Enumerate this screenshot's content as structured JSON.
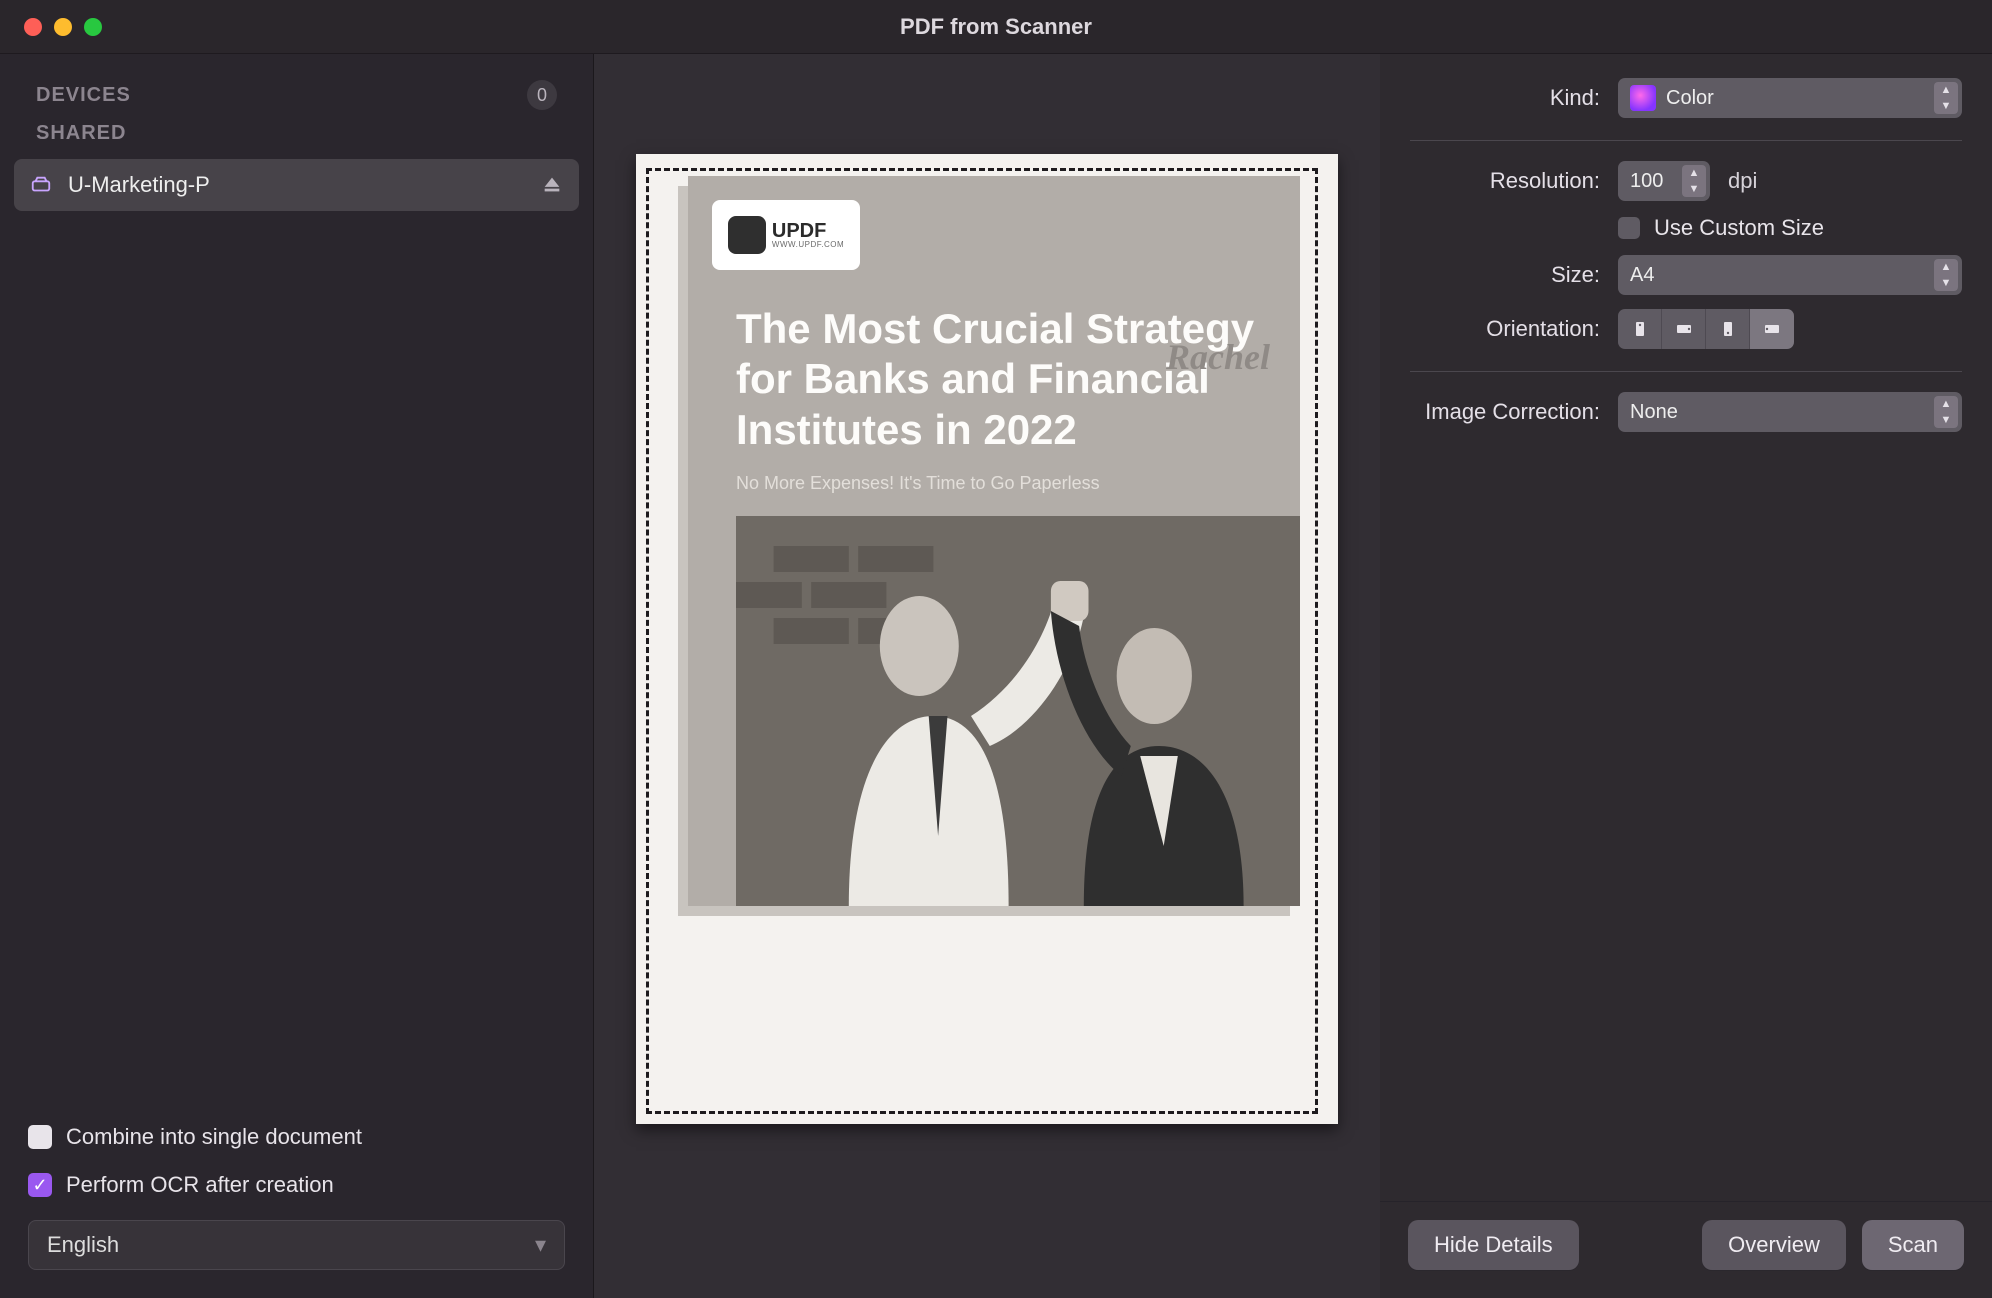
{
  "window": {
    "title": "PDF from Scanner"
  },
  "sidebar": {
    "devices_label": "DEVICES",
    "devices_count": "0",
    "shared_label": "SHARED",
    "scanner_name": "U-Marketing-P"
  },
  "options": {
    "combine_label": "Combine into single document",
    "ocr_label": "Perform OCR after creation",
    "language": "English"
  },
  "preview": {
    "logo_brand": "UPDF",
    "logo_url": "WWW.UPDF.COM",
    "headline": "The Most Crucial Strategy for Banks and Financial Institutes in 2022",
    "watermark": "Rachel",
    "subhead": "No More Expenses! It's Time to Go Paperless"
  },
  "settings": {
    "kind_label": "Kind:",
    "kind_value": "Color",
    "resolution_label": "Resolution:",
    "resolution_value": "100",
    "resolution_unit": "dpi",
    "custom_size_label": "Use Custom Size",
    "size_label": "Size:",
    "size_value": "A4",
    "orientation_label": "Orientation:",
    "correction_label": "Image Correction:",
    "correction_value": "None"
  },
  "buttons": {
    "hide_details": "Hide Details",
    "overview": "Overview",
    "scan": "Scan"
  }
}
